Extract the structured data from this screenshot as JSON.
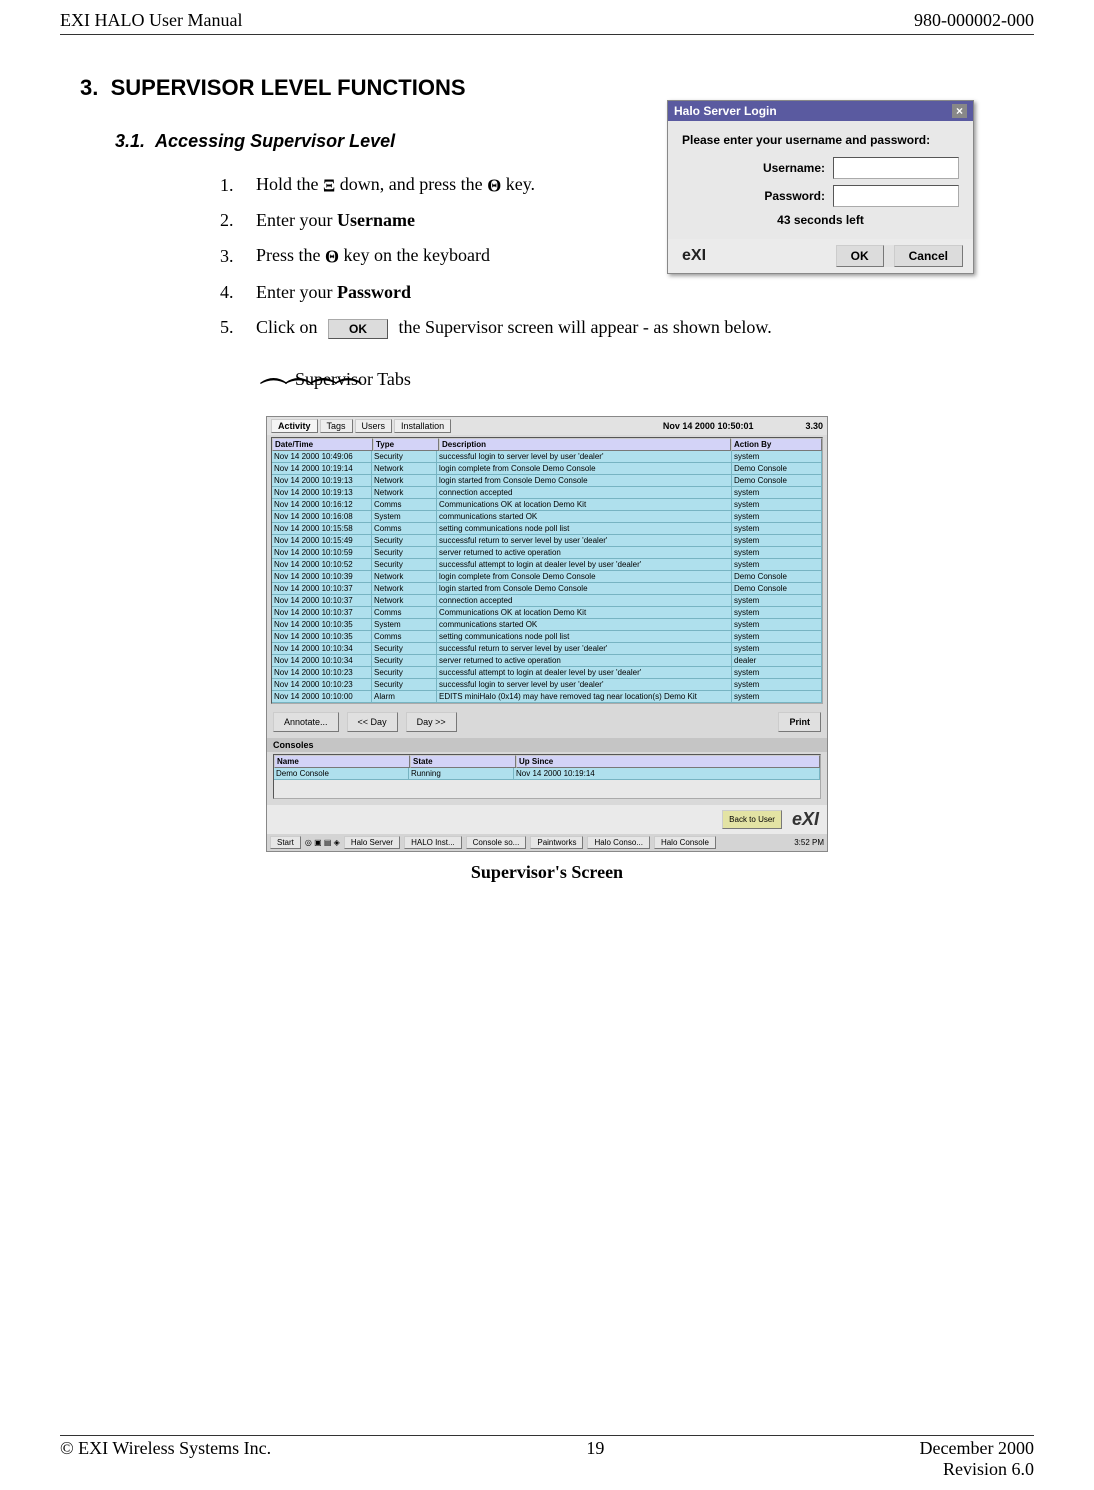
{
  "header": {
    "left": "EXI HALO User Manual",
    "right": "980-000002-000"
  },
  "section": {
    "number": "3.",
    "title": "SUPERVISOR LEVEL FUNCTIONS"
  },
  "subsection": {
    "number": "3.1.",
    "title": "Accessing Supervisor Level"
  },
  "steps": {
    "s1_pre": "Hold the ",
    "s1_mid": " down, and press the ",
    "s1_post": " key.",
    "s2_pre": "Enter your ",
    "s2_bold": "Username",
    "s3_pre": "Press the ",
    "s3_post": " key on the keyboard",
    "s4_pre": "Enter your ",
    "s4_bold": "Password",
    "s5_pre": "Click on ",
    "s5_post": " the Supervisor screen will appear - as shown below."
  },
  "glyphs": {
    "xi": "Ξ",
    "theta": "Θ"
  },
  "login": {
    "title": "Halo Server Login",
    "prompt": "Please enter your username and password:",
    "username_label": "Username:",
    "password_label": "Password:",
    "seconds": "43 seconds left",
    "ok": "OK",
    "cancel": "Cancel",
    "logo": "XI"
  },
  "inline_ok": "OK",
  "supervisor_tabs_label": "Supervisor Tabs",
  "sv": {
    "tabs": [
      "Activity",
      "Tags",
      "Users",
      "Installation"
    ],
    "datetime": "Nov 14 2000   10:50:01",
    "version": "3.30",
    "columns": [
      "Date/Time",
      "Type",
      "Description",
      "Action By"
    ],
    "rows": [
      [
        "Nov 14 2000  10:49:06",
        "Security",
        "successful login to server level by user 'dealer'",
        "system"
      ],
      [
        "Nov 14 2000  10:19:14",
        "Network",
        "login complete from Console Demo Console",
        "Demo Console"
      ],
      [
        "Nov 14 2000  10:19:13",
        "Network",
        "login started from Console Demo Console",
        "Demo Console"
      ],
      [
        "Nov 14 2000  10:19:13",
        "Network",
        "connection accepted",
        "system"
      ],
      [
        "Nov 14 2000  10:16:12",
        "Comms",
        "Communications OK at location Demo Kit",
        "system"
      ],
      [
        "Nov 14 2000  10:16:08",
        "System",
        "communications started OK",
        "system"
      ],
      [
        "Nov 14 2000  10:15:58",
        "Comms",
        "setting communications node poll list",
        "system"
      ],
      [
        "Nov 14 2000  10:15:49",
        "Security",
        "successful return to server level by user 'dealer'",
        "system"
      ],
      [
        "Nov 14 2000  10:10:59",
        "Security",
        "server returned to active operation",
        "system"
      ],
      [
        "Nov 14 2000  10:10:52",
        "Security",
        "successful attempt to login at dealer level by user 'dealer'",
        "system"
      ],
      [
        "Nov 14 2000  10:10:39",
        "Network",
        "login complete from Console Demo Console",
        "Demo Console"
      ],
      [
        "Nov 14 2000  10:10:37",
        "Network",
        "login started from Console Demo Console",
        "Demo Console"
      ],
      [
        "Nov 14 2000  10:10:37",
        "Network",
        "connection accepted",
        "system"
      ],
      [
        "Nov 14 2000  10:10:37",
        "Comms",
        "Communications OK at location Demo Kit",
        "system"
      ],
      [
        "Nov 14 2000  10:10:35",
        "System",
        "communications started OK",
        "system"
      ],
      [
        "Nov 14 2000  10:10:35",
        "Comms",
        "setting communications node poll list",
        "system"
      ],
      [
        "Nov 14 2000  10:10:34",
        "Security",
        "successful return to server level by user 'dealer'",
        "system"
      ],
      [
        "Nov 14 2000  10:10:34",
        "Security",
        "server returned to active operation",
        "dealer"
      ],
      [
        "Nov 14 2000  10:10:23",
        "Security",
        "successful attempt to login at dealer level by user 'dealer'",
        "system"
      ],
      [
        "Nov 14 2000  10:10:23",
        "Security",
        "successful login to server level by user 'dealer'",
        "system"
      ],
      [
        "Nov 14 2000  10:10:00",
        "Alarm",
        "EDITS miniHalo (0x14) may have removed tag near location(s) Demo Kit",
        "system"
      ]
    ],
    "mid_buttons": {
      "ann": "Annotate...",
      "day_back": "<< Day",
      "day_fwd": "Day >>",
      "print": "Print"
    },
    "consoles_label": "Consoles",
    "console_columns": [
      "Name",
      "State",
      "Up Since"
    ],
    "console_row": [
      "Demo Console",
      "Running",
      "Nov 14 2000  10:19:14"
    ],
    "back_to_user": "Back to User",
    "xi_logo": "XI",
    "taskbar": {
      "start": "Start",
      "items": [
        "Halo Server",
        "HALO Inst...",
        "Console so...",
        "Paintworks",
        "Halo Conso...",
        "Halo Console"
      ],
      "clock": "3:52 PM"
    }
  },
  "caption": "Supervisor's Screen",
  "footer": {
    "left": "© EXI Wireless Systems Inc.",
    "center": "19",
    "right_line1": "December 2000",
    "right_line2": "Revision 6.0"
  }
}
